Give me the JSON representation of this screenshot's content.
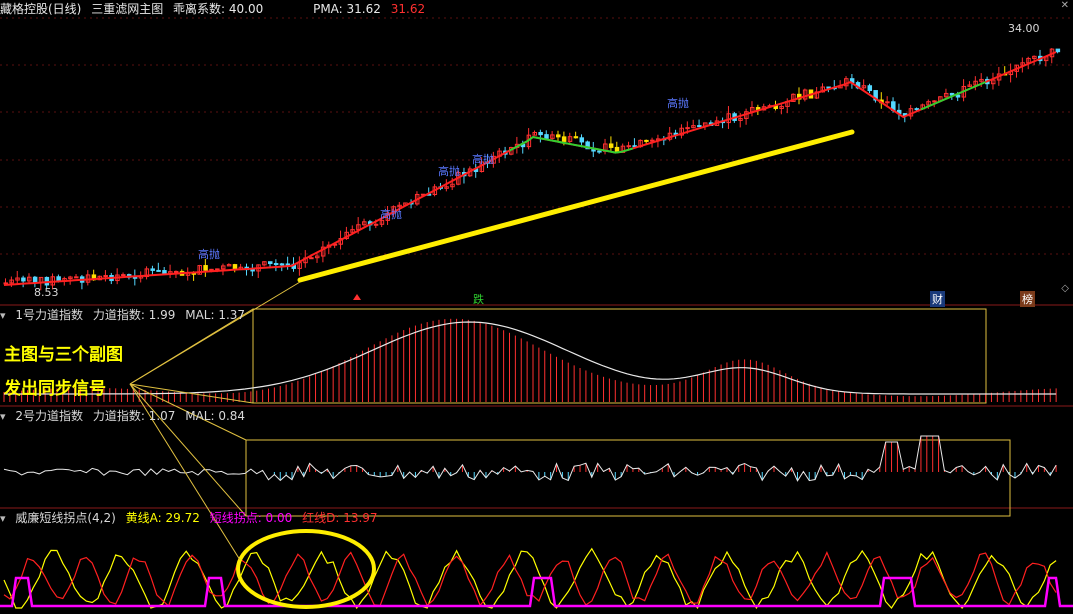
{
  "main_panel": {
    "title": "藏格控股(日线)",
    "indicator": "三重滤网主图",
    "deviation_label": "乖离系数: 40.00",
    "pma_label": "PMA: 31.62",
    "pma_value_red": "31.62",
    "high_label": "34.00",
    "low_label": "8.53",
    "signals": [
      "高抛",
      "高抛",
      "高抛",
      "高抛",
      "高抛"
    ],
    "bottom_markers": {
      "fall": "跌",
      "finance": "财",
      "rank": "榜"
    }
  },
  "sub1": {
    "title": "1号力道指数",
    "name": "力道指数: 1.99",
    "mal": "MAL: 1.37"
  },
  "sub2": {
    "title": "2号力道指数",
    "name": "力道指数: 1.07",
    "mal": "MAL: 0.84"
  },
  "sub3": {
    "title": "威廉短线拐点(4,2)",
    "yellow": "黄线A: 29.72",
    "short": "短线拐点: 0.00",
    "red": "红线D: 13.97"
  },
  "annotation": {
    "line1": "主图与三个副图",
    "line2": "发出同步信号"
  },
  "colors": {
    "bg": "#000000",
    "up": "#ff3030",
    "down": "#54d8ff",
    "ma_red": "#ff2020",
    "ma_green": "#30d030",
    "yellow": "#ffff00",
    "magenta": "#ff00ff"
  },
  "icons": {
    "gear": "gear-icon",
    "diamond": "diamond-icon"
  }
}
